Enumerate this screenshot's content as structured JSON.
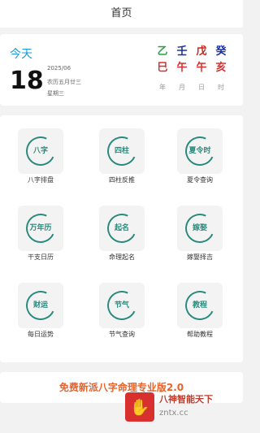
{
  "header": {
    "title": "首页"
  },
  "date": {
    "today_label": "今天",
    "day": "18",
    "year_month": "2025/06",
    "lunar": "农历五月廿三",
    "weekday": "星期三"
  },
  "ganzhi": [
    {
      "stem": "乙",
      "stem_color": "#2e9c4a",
      "branch": "巳",
      "label": "年"
    },
    {
      "stem": "壬",
      "stem_color": "#1a2ea8",
      "branch": "午",
      "label": "月"
    },
    {
      "stem": "戊",
      "stem_color": "#c8281c",
      "branch": "午",
      "label": "日"
    },
    {
      "stem": "癸",
      "stem_color": "#1a2ea8",
      "branch": "亥",
      "label": "时"
    }
  ],
  "features": [
    {
      "seal": "八字",
      "label": "八字排盘"
    },
    {
      "seal": "四柱",
      "label": "四柱反推"
    },
    {
      "seal": "夏令时",
      "label": "夏令查询"
    },
    {
      "seal": "万年历",
      "label": "干支日历"
    },
    {
      "seal": "起名",
      "label": "命理起名"
    },
    {
      "seal": "嫁娶",
      "label": "嫁娶择吉"
    },
    {
      "seal": "财运",
      "label": "每日运势"
    },
    {
      "seal": "节气",
      "label": "节气查询"
    },
    {
      "seal": "教程",
      "label": "帮助教程"
    }
  ],
  "promo": {
    "text": "免费新派八字命理专业版2.0"
  },
  "watermark": {
    "logo": "✋",
    "title": "八神智能天下",
    "url": "zntx.cc"
  },
  "colors": {
    "accent": "#1e9bd7",
    "seal": "#2b8a7e",
    "promo": "#e8622a",
    "branch": "#d8302f"
  }
}
